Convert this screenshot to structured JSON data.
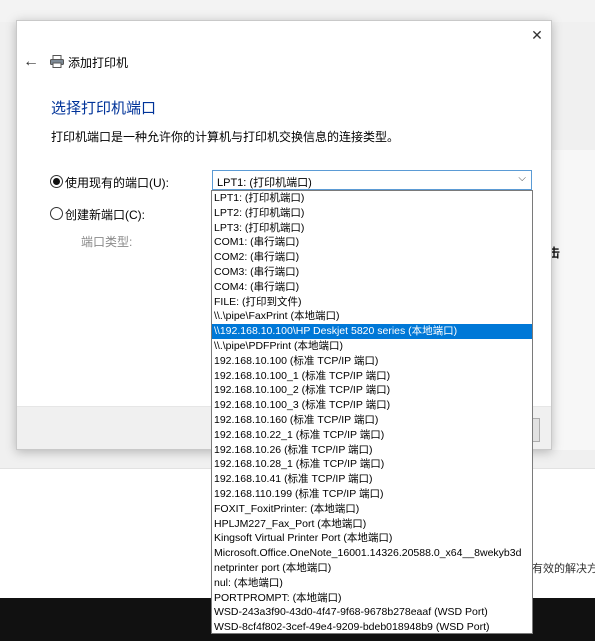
{
  "dialog": {
    "title": "添加打印机",
    "close_glyph": "✕",
    "back_glyph": "←",
    "heading": "选择打印机端口",
    "description": "打印机端口是一种允许你的计算机与打印机交换信息的连接类型。",
    "option_existing_label": "使用现有的端口(U):",
    "option_new_label": "创建新端口(C):",
    "port_type_label": "端口类型:",
    "existing_selected": true
  },
  "combo": {
    "value": "LPT1: (打印机端口)",
    "arrow_glyph": "⌵"
  },
  "dropdown": {
    "selected_index": 9,
    "items": [
      "LPT1: (打印机端口)",
      "LPT2: (打印机端口)",
      "LPT3: (打印机端口)",
      "COM1: (串行端口)",
      "COM2: (串行端口)",
      "COM3: (串行端口)",
      "COM4: (串行端口)",
      "FILE: (打印到文件)",
      "\\\\.\\pipe\\FaxPrint (本地端口)",
      "\\\\192.168.10.100\\HP Deskjet 5820 series (本地端口)",
      "\\\\.\\pipe\\PDFPrint (本地端口)",
      "192.168.10.100 (标准 TCP/IP 端口)",
      "192.168.10.100_1 (标准 TCP/IP 端口)",
      "192.168.10.100_2 (标准 TCP/IP 端口)",
      "192.168.10.100_3 (标准 TCP/IP 端口)",
      "192.168.10.160 (标准 TCP/IP 端口)",
      "192.168.10.22_1 (标准 TCP/IP 端口)",
      "192.168.10.26 (标准 TCP/IP 端口)",
      "192.168.10.28_1 (标准 TCP/IP 端口)",
      "192.168.10.41 (标准 TCP/IP 端口)",
      "192.168.110.199 (标准 TCP/IP 端口)",
      "FOXIT_FoxitPrinter: (本地端口)",
      "HPLJM227_Fax_Port (本地端口)",
      "Kingsoft Virtual Printer Port (本地端口)",
      "Microsoft.Office.OneNote_16001.14326.20588.0_x64__8wekyb3d",
      "netprinter port (本地端口)",
      "nul: (本地端口)",
      "PORTPROMPT: (本地端口)",
      "WSD-243a3f90-43d0-4f47-9f68-9678b278eaaf (WSD Port)",
      "WSD-8cf4f802-3cef-49e4-9209-bdeb018948b9 (WSD Port)"
    ]
  },
  "background": {
    "right_panel_text": "击",
    "bottom_text": "有效的解决方"
  }
}
